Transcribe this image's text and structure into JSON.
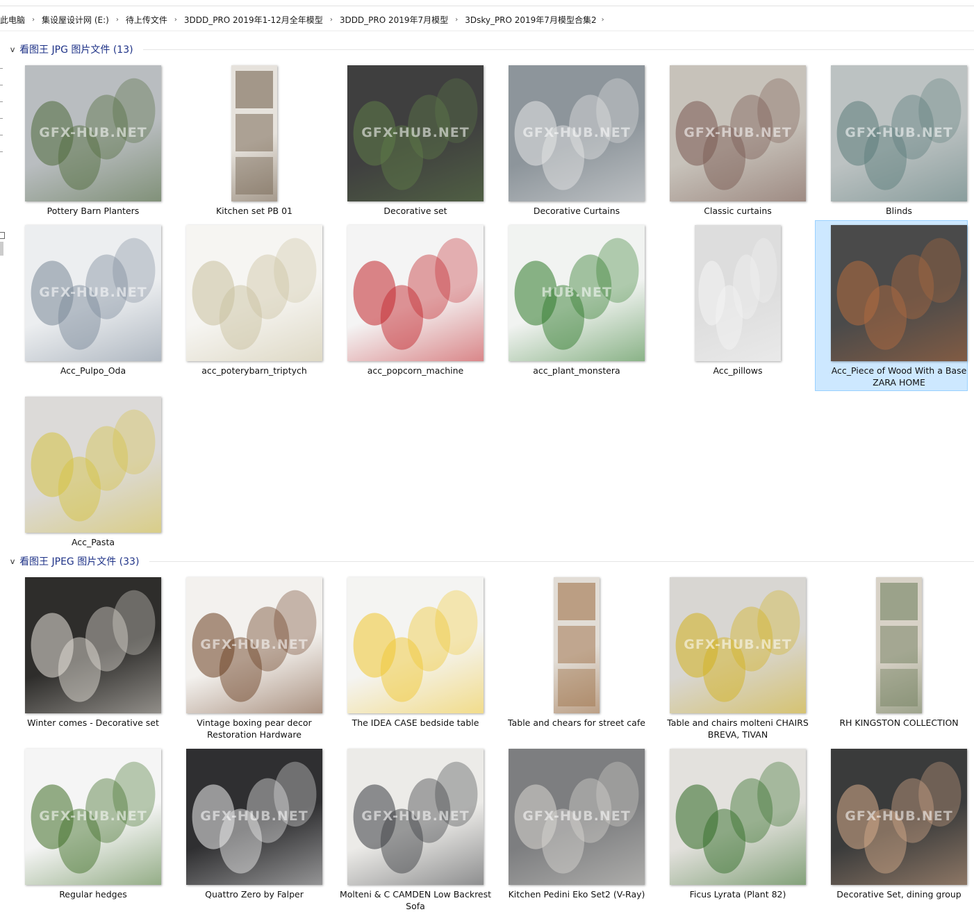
{
  "breadcrumb": [
    "此电脑",
    "集设屋设计网 (E:)",
    "待上传文件",
    "3DDD_PRO 2019年1-12月全年模型",
    "3DDD_PRO 2019年7月模型",
    "3Dsky_PRO 2019年7月模型合集2"
  ],
  "groups": [
    {
      "title": "看图王 JPG 图片文件 (13)",
      "items": [
        {
          "name": "Pottery Barn Planters",
          "bg": "#b9bdc0",
          "fg": "#4f6a3a",
          "shape": "square",
          "wm": "GFX-HUB.NET"
        },
        {
          "name": "Kitchen set PB 01",
          "bg": "#e6e2dc",
          "fg": "#6c5a46",
          "shape": "tall"
        },
        {
          "name": "Decorative set",
          "bg": "#3f3f3f",
          "fg": "#5f7c48",
          "shape": "square",
          "wm": "GFX-HUB.NET"
        },
        {
          "name": "Decorative Curtains",
          "bg": "#8d959b",
          "fg": "#e6e6e6",
          "shape": "square",
          "wm": "GFX-HUB.NET"
        },
        {
          "name": "Classic curtains",
          "bg": "#c7c2ba",
          "fg": "#7a5a52",
          "shape": "square",
          "wm": "GFX-HUB.NET"
        },
        {
          "name": "Blinds",
          "bg": "#bcc2c2",
          "fg": "#5d7d7c",
          "shape": "square",
          "wm": "GFX-HUB.NET"
        },
        {
          "name": "Acc_Pulpo_Oda",
          "bg": "#eceef0",
          "fg": "#7a8898",
          "shape": "square",
          "wm": "GFX-HUB.NET"
        },
        {
          "name": "acc_poterybarn_triptych",
          "bg": "#f6f5f2",
          "fg": "#c9c09e",
          "shape": "square"
        },
        {
          "name": "acc_popcorn_machine",
          "bg": "#f4f4f4",
          "fg": "#c2262b",
          "shape": "square"
        },
        {
          "name": "acc_plant_monstera",
          "bg": "#f1f3f1",
          "fg": "#2f7a2a",
          "shape": "square",
          "wm": "HUB.NET"
        },
        {
          "name": "Acc_pillows",
          "bg": "#dddddd",
          "fg": "#f4f4f4",
          "shape": "portrait"
        },
        {
          "name": "Acc_Piece of Wood With a Base ZARA HOME",
          "bg": "#4a4a4a",
          "fg": "#b26b3e",
          "shape": "square",
          "selected": true
        },
        {
          "name": "Acc_Pasta",
          "bg": "#dcdad8",
          "fg": "#d6c241",
          "shape": "square"
        }
      ]
    },
    {
      "title": "看图王 JPEG 图片文件 (33)",
      "items": [
        {
          "name": "Winter comes - Decorative set",
          "bg": "#2e2d2b",
          "fg": "#e9e4dc",
          "shape": "square"
        },
        {
          "name": "Vintage boxing pear decor Restoration Hardware",
          "bg": "#f3f1ee",
          "fg": "#6b3f22",
          "shape": "square",
          "wm": "GFX-HUB.NET"
        },
        {
          "name": "The IDEA CASE bedside table",
          "bg": "#f4f4f2",
          "fg": "#f0c730",
          "shape": "square"
        },
        {
          "name": "Table and chears for street cafe",
          "bg": "#e2ddd6",
          "fg": "#9a6a40",
          "shape": "tall"
        },
        {
          "name": "Table and chairs molteni CHAIRS BREVA, TIVAN",
          "bg": "#d8d6d2",
          "fg": "#d4b21d",
          "shape": "square",
          "wm": "GFX-HUB.NET"
        },
        {
          "name": "RH KINGSTON COLLECTION",
          "bg": "#d8d2c7",
          "fg": "#6a7a58",
          "shape": "tall"
        },
        {
          "name": "Regular hedges",
          "bg": "#f5f5f5",
          "fg": "#3f6e26",
          "shape": "square",
          "wm": "GFX-HUB.NET"
        },
        {
          "name": "Quattro Zero by Falper",
          "bg": "#2f2f31",
          "fg": "#eeeeee",
          "shape": "square",
          "wm": "GFX-HUB.NET"
        },
        {
          "name": "Molteni & C CAMDEN Low Backrest Sofa",
          "bg": "#ecebe8",
          "fg": "#3b3d41",
          "shape": "square",
          "wm": "GFX-HUB.NET"
        },
        {
          "name": "Kitchen Pedini Eko Set2 (V-Ray)",
          "bg": "#7d7e80",
          "fg": "#d8d6d0",
          "shape": "square",
          "wm": "GFX-HUB.NET"
        },
        {
          "name": "Ficus Lyrata (Plant 82)",
          "bg": "#e3e1dd",
          "fg": "#2f6a23",
          "shape": "square"
        },
        {
          "name": "Decorative Set, dining group",
          "bg": "#3a3b3b",
          "fg": "#d6ab8a",
          "shape": "square",
          "wm": "GFX-HUB.NET"
        }
      ]
    }
  ]
}
